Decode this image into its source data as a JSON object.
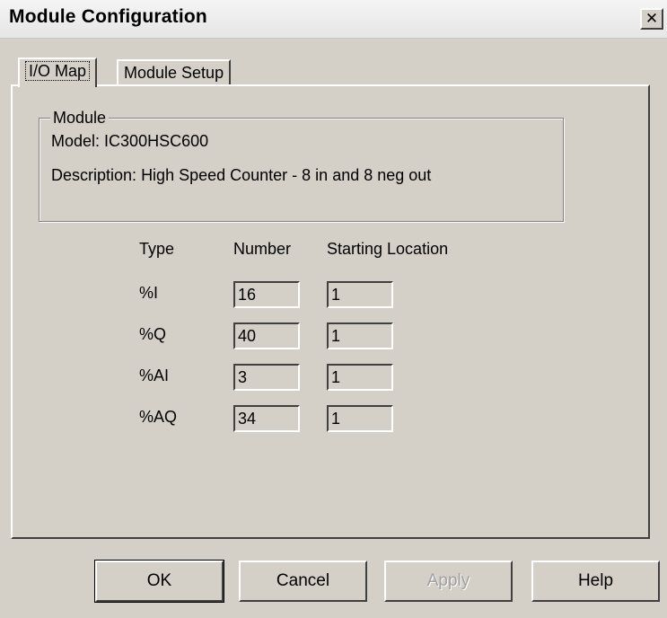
{
  "window": {
    "title": "Module Configuration",
    "close_label": "✕"
  },
  "tabs": [
    {
      "label": "I/O Map",
      "active": true
    },
    {
      "label": "Module Setup",
      "active": false
    }
  ],
  "module_group": {
    "legend": "Module",
    "model_label": "Model:",
    "model_value": "IC300HSC600",
    "description_label": "Description:",
    "description_value": "High Speed Counter - 8 in and 8 neg out"
  },
  "io_table": {
    "headers": {
      "type": "Type",
      "number": "Number",
      "start": "Starting Location"
    },
    "rows": [
      {
        "type": "%I",
        "number": "16",
        "start": "1"
      },
      {
        "type": "%Q",
        "number": "40",
        "start": "1"
      },
      {
        "type": "%AI",
        "number": "3",
        "start": "1"
      },
      {
        "type": "%AQ",
        "number": "34",
        "start": "1"
      }
    ]
  },
  "buttons": {
    "ok": "OK",
    "cancel": "Cancel",
    "apply": "Apply",
    "help": "Help"
  }
}
